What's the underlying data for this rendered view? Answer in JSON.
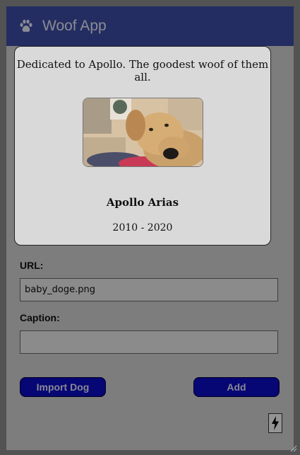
{
  "header": {
    "title": "Woof App",
    "icon": "paw-icon",
    "color": "#3f4fa8"
  },
  "form": {
    "url_label": "URL:",
    "url_value": "baby_doge.png",
    "caption_label": "Caption:",
    "caption_value": ""
  },
  "buttons": {
    "import_label": "Import Dog",
    "add_label": "Add",
    "color": "#0c0cc9"
  },
  "fab": {
    "icon": "lightning-bolt-icon"
  },
  "modal": {
    "dedication": "Dedicated to Apollo. The goodest woof of them all.",
    "photo_icon": "dog-photo",
    "name": "Apollo Arias",
    "years": "2010 - 2020"
  }
}
